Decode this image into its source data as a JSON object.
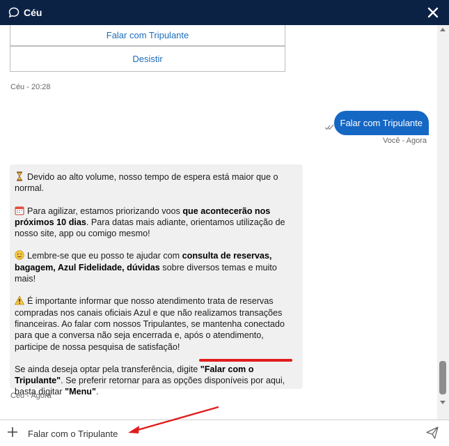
{
  "header": {
    "title": "Céu",
    "chat_icon": "chat-bubble-icon",
    "close_icon": "close-icon"
  },
  "options": {
    "option1": "Falar com Tripulante",
    "option2": "Desistir"
  },
  "bot_timestamp_1": "Céu - 20:28",
  "user_message": {
    "text": "Falar com Tripulante",
    "meta": "Você - Agora",
    "status_icon": "double-check-icon"
  },
  "bot_message": {
    "p1": "Devido ao alto volume, nosso tempo de espera está maior que o normal.",
    "p2_a": "Para agilizar, estamos priorizando voos ",
    "p2_b": "que acontecerão nos próximos 10 dias",
    "p2_c": ". Para datas mais adiante, orientamos utilização de nosso site, app ou comigo mesmo!",
    "p3_a": "Lembre-se que eu posso te ajudar com ",
    "p3_b": "consulta de reservas, bagagem, Azul Fidelidade, dúvidas",
    "p3_c": " sobre diversos temas e muito mais!",
    "p4": "É importante informar que nosso atendimento trata de reservas compradas nos canais oficiais Azul e que não realizamos transações financeiras. Ao falar com nossos Tripulantes, se mantenha conectado para que a conversa não seja encerrada e, após o atendimento, participe de nossa pesquisa de satisfação!",
    "p5_a": "Se ainda deseja optar pela transferência, digite ",
    "p5_b": "\"Falar com o Tripulante\"",
    "p5_c": ". Se preferir retornar para as opções disponíveis por aqui, basta digitar ",
    "p5_d": "\"Menu\"",
    "p5_e": ".",
    "meta": "Céu - Agora"
  },
  "input": {
    "value": "Falar com o Tripulante",
    "add_icon": "plus-icon",
    "send_icon": "send-icon"
  },
  "colors": {
    "header": "#0c2245",
    "user_bubble": "#1567c4",
    "link": "#1d6cb9",
    "annotation": "#e11d1d"
  }
}
